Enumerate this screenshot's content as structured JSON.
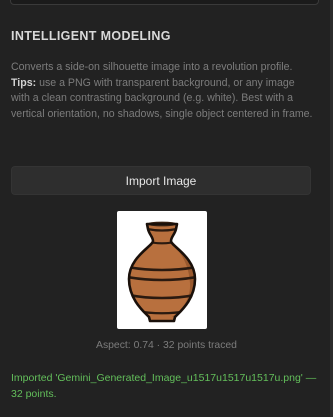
{
  "panel": {
    "section_title": "INTELLIGENT MODELING",
    "description": "Converts a side-on silhouette image into a revolution profile.",
    "tips_label": "Tips:",
    "tips_text": " use a PNG with transparent background, or any image with a clean contrasting background (e.g. white). Best with a vertical orientation, no shadows, single object centered in frame.",
    "import_button_label": "Import Image",
    "preview_icon": "vase-icon",
    "aspect_text": "Aspect: 0.74 · 32 points traced",
    "status_text": "Imported 'Gemini_Generated_Image_u1517u1517u1517u.png' — 32 points."
  },
  "colors": {
    "background": "#222222",
    "status_success": "#63bf5b",
    "muted_text": "#7c7c7c",
    "vase_body": "#b8703e",
    "vase_bands": "#2a1a10"
  }
}
